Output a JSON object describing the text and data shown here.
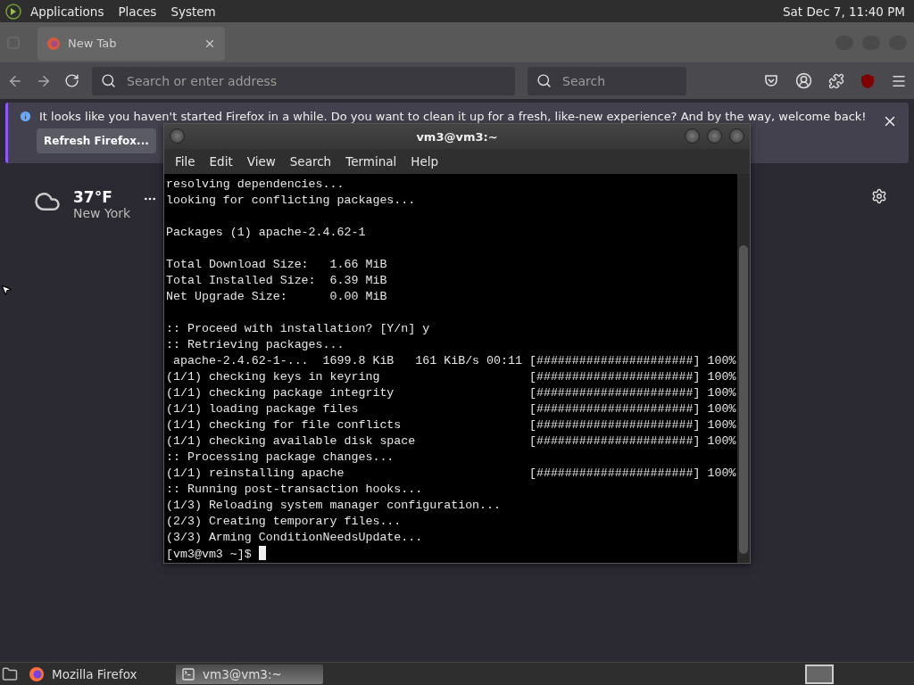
{
  "top_panel": {
    "menus": [
      "Applications",
      "Places",
      "System"
    ],
    "clock": "Sat Dec 7, 11:40 PM"
  },
  "browser": {
    "tabs": [
      {
        "label": "New Tab",
        "selected": true
      }
    ],
    "address": {
      "placeholder": "Search or enter address"
    },
    "search": {
      "placeholder": "Search"
    },
    "notification": {
      "message": "It looks like you haven't started Firefox in a while. Do you want to clean it up for a fresh, like-new experience? And by the way, welcome back!",
      "button": "Refresh Firefox..."
    },
    "weather": {
      "temperature": "37°F",
      "city": "New York"
    }
  },
  "terminal": {
    "title": "vm3@vm3:~",
    "menus": [
      "File",
      "Edit",
      "View",
      "Search",
      "Terminal",
      "Help"
    ],
    "blocks": [
      [
        "resolving dependencies...",
        "looking for conflicting packages..."
      ],
      [
        "Packages (1) apache-2.4.62-1"
      ],
      [
        "Total Download Size:   1.66 MiB",
        "Total Installed Size:  6.39 MiB",
        "Net Upgrade Size:      0.00 MiB"
      ],
      [
        ":: Proceed with installation? [Y/n] y",
        ":: Retrieving packages...",
        " apache-2.4.62-1-...  1699.8 KiB   161 KiB/s 00:11 [######################] 100%",
        "(1/1) checking keys in keyring                     [######################] 100%",
        "(1/1) checking package integrity                   [######################] 100%",
        "(1/1) loading package files                        [######################] 100%",
        "(1/1) checking for file conflicts                  [######################] 100%",
        "(1/1) checking available disk space                [######################] 100%",
        ":: Processing package changes...",
        "(1/1) reinstalling apache                          [######################] 100%",
        ":: Running post-transaction hooks...",
        "(1/3) Reloading system manager configuration...",
        "(2/3) Creating temporary files...",
        "(3/3) Arming ConditionNeedsUpdate..."
      ]
    ],
    "prompt": "[vm3@vm3 ~]$ "
  },
  "taskbar": {
    "items": [
      {
        "label": "Mozilla Firefox",
        "kind": "browser",
        "selected": false
      },
      {
        "label": "vm3@vm3:~",
        "kind": "terminal",
        "selected": true
      }
    ]
  }
}
